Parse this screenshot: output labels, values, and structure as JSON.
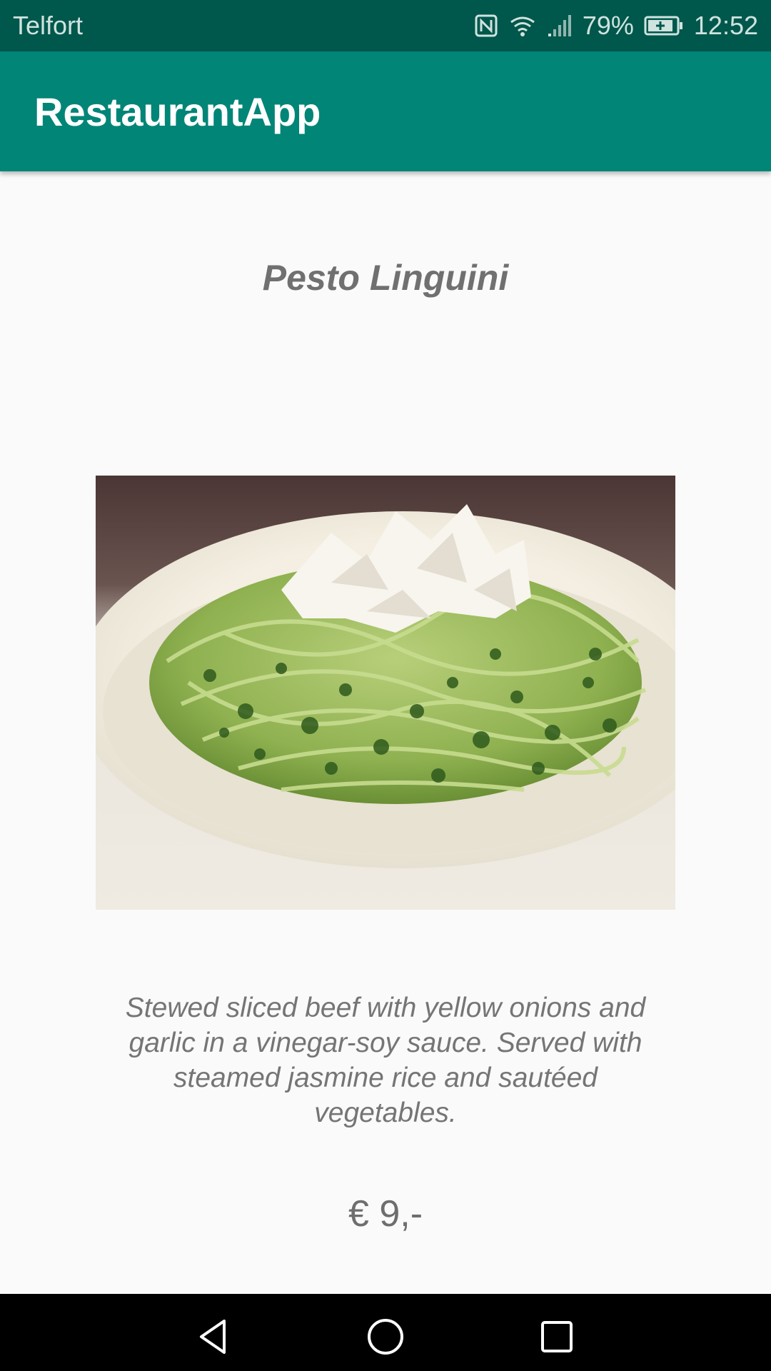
{
  "status_bar": {
    "carrier": "Telfort",
    "battery": "79%",
    "time": "12:52"
  },
  "app_bar": {
    "title": "RestaurantApp"
  },
  "dish": {
    "name": "Pesto Linguini",
    "description": "Stewed sliced beef with yellow onions and garlic in a vinegar-soy sauce. Served with steamed jasmine rice and sautéed vegetables.",
    "price": "€ 9,-"
  },
  "nav_bar": {
    "back_icon": "back-triangle-icon",
    "home_icon": "home-circle-icon",
    "recents_icon": "recents-square-icon"
  },
  "colors": {
    "status_bar": "#00574b",
    "app_bar": "#008577",
    "background": "#fafafa",
    "text_gray": "#707070"
  }
}
